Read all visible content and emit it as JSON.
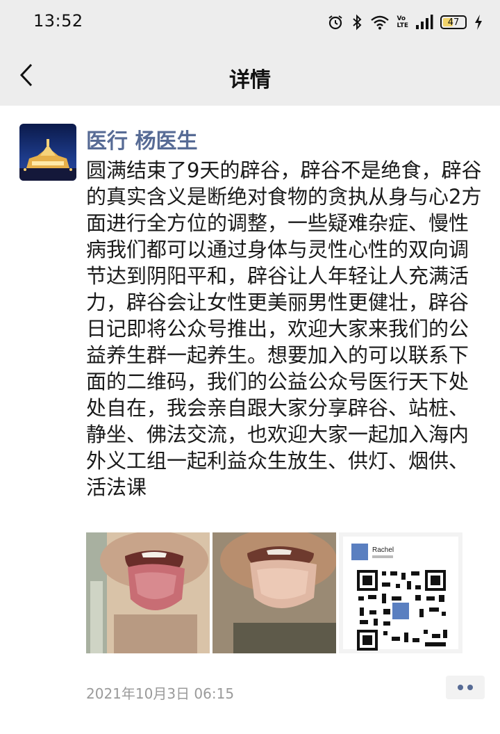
{
  "status_bar": {
    "time": "13:52",
    "network_label_top": "Vo",
    "network_label_bottom": "LTE",
    "battery_level": "47",
    "icons": [
      "alarm-icon",
      "bluetooth-icon",
      "wifi-icon",
      "signal-icon",
      "battery-icon",
      "charging-icon"
    ]
  },
  "nav": {
    "title": "详情",
    "back_icon": "chevron-left-icon"
  },
  "post": {
    "author": "医行 杨医生",
    "content": "圆满结束了9天的辟谷，辟谷不是绝食，辟谷的真实含义是断绝对食物的贪执从身与心2方面进行全方位的调整，一些疑难杂症、慢性病我们都可以通过身体与灵性心性的双向调节达到阴阳平和，辟谷让人年轻让人充满活力，辟谷会让女性更美丽男性更健壮，辟谷日记即将公众号推出，欢迎大家来我们的公益养生群一起养生。想要加入的可以联系下面的二维码，我们的公益公众号医行天下处处自在，我会亲自跟大家分享辟谷、站桩、静坐、佛法交流，也欢迎大家一起加入海内外义工组一起利益众生放生、供灯、烟供、活法课",
    "photos": [
      {
        "subject": "tongue-photo-1"
      },
      {
        "subject": "tongue-photo-2"
      },
      {
        "subject": "qr-code-card",
        "card_name": "Rachel"
      }
    ],
    "timestamp": "2021年10月3日 06:15",
    "more_icon": "more-dots-icon"
  },
  "colors": {
    "bar_bg": "#ededed",
    "author_blue": "#576b95",
    "timestamp_gray": "#9a9a9a"
  }
}
